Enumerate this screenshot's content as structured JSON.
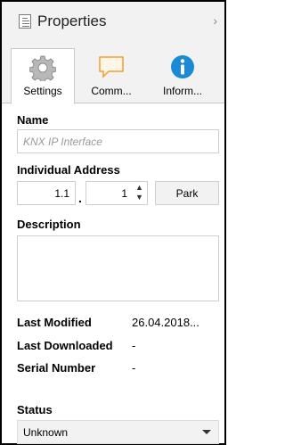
{
  "header": {
    "title": "Properties",
    "collapse_glyph": "›"
  },
  "tabs": [
    {
      "label": "Settings",
      "icon": "gear-icon"
    },
    {
      "label": "Comm...",
      "icon": "comment-icon"
    },
    {
      "label": "Inform...",
      "icon": "info-icon"
    }
  ],
  "name": {
    "label": "Name",
    "placeholder": "KNX IP Interface"
  },
  "address": {
    "label": "Individual Address",
    "area_line": "1.1",
    "separator": ".",
    "device": "1",
    "up_glyph": "▲",
    "down_glyph": "▼",
    "park_label": "Park"
  },
  "description": {
    "label": "Description",
    "value": ""
  },
  "info": {
    "last_modified_label": "Last Modified",
    "last_modified_value": "26.04.2018...",
    "last_downloaded_label": "Last Downloaded",
    "last_downloaded_value": "-",
    "serial_label": "Serial Number",
    "serial_value": "-"
  },
  "status": {
    "label": "Status",
    "value": "Unknown"
  },
  "colors": {
    "accent_blue": "#1a8ad4",
    "note_orange": "#f0a030"
  }
}
